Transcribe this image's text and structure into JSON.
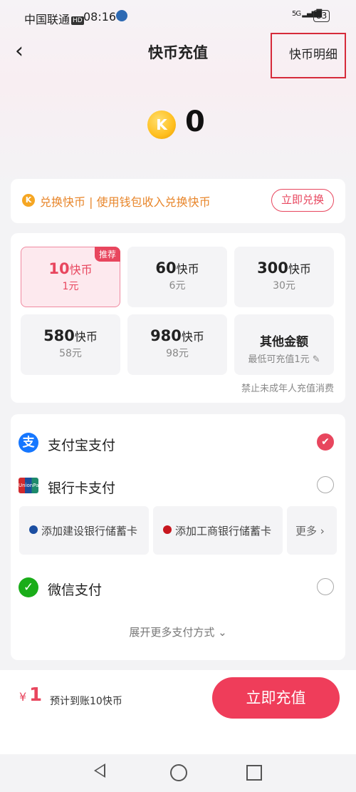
{
  "status_bar": {
    "carrier": "中国联通",
    "hd": "HD",
    "time": "08:16",
    "network": "5G",
    "battery": "83"
  },
  "header": {
    "title": "快币充值",
    "detail_link": "快币明细",
    "back_icon": "chevron-left-icon"
  },
  "balance": {
    "coin_symbol": "K",
    "value": "0"
  },
  "exchange": {
    "coin_symbol": "K",
    "text": "兑换快币 | 使用钱包收入兑换快币",
    "button": "立即兑换"
  },
  "packs": [
    {
      "amount": "10",
      "unit": "快币",
      "price": "1元",
      "badge": "推荐",
      "selected": true
    },
    {
      "amount": "60",
      "unit": "快币",
      "price": "6元"
    },
    {
      "amount": "300",
      "unit": "快币",
      "price": "30元"
    },
    {
      "amount": "580",
      "unit": "快币",
      "price": "58元"
    },
    {
      "amount": "980",
      "unit": "快币",
      "price": "98元"
    }
  ],
  "other_amount": {
    "title": "其他金额",
    "subtitle": "最低可充值1元"
  },
  "notice": "禁止未成年人充值消费",
  "payment": {
    "alipay": {
      "label": "支付宝支付",
      "icon_text": "支",
      "checked": true
    },
    "bankcard": {
      "label": "银行卡支付",
      "icon_text": "UnionPay 银联"
    },
    "bank_chips": [
      "添加建设银行储蓄卡",
      "添加工商银行储蓄卡",
      "更多"
    ],
    "wechat": {
      "label": "微信支付"
    },
    "expand": "展开更多支付方式"
  },
  "footer": {
    "currency": "¥",
    "total": "1",
    "expect": "预计到账10快币",
    "pay_button": "立即充值"
  },
  "colors": {
    "accent": "#ef3d5a",
    "coin": "#ffbf1f",
    "exchange_text": "#e8862b",
    "highlight_box": "#d62b3a"
  }
}
